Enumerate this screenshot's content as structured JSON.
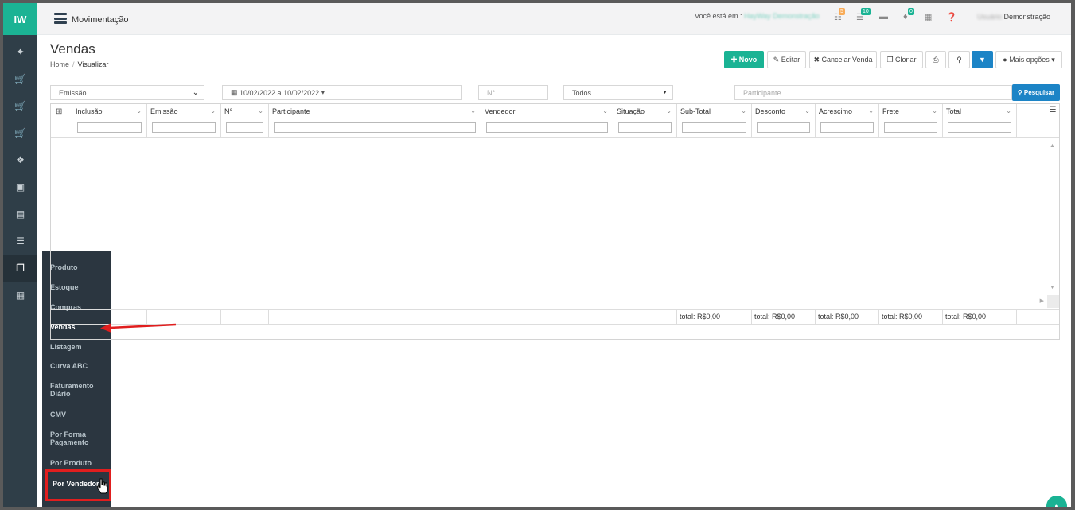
{
  "sidebar": {
    "logo": "IW",
    "icons": [
      "pin-icon",
      "cart-icon",
      "cart-icon",
      "cart-icon",
      "cubes-icon",
      "cube-icon",
      "inbox-icon",
      "list-icon",
      "reports-icon",
      "document-icon"
    ]
  },
  "flyout": {
    "items": [
      {
        "label": "Produto"
      },
      {
        "label": "Estoque"
      },
      {
        "label": "Compras"
      },
      {
        "label": "Vendas"
      },
      {
        "label": "Listagem"
      },
      {
        "label": "Curva ABC"
      },
      {
        "label": "Faturamento\nDiário"
      },
      {
        "label": "CMV"
      },
      {
        "label": "Por Forma\nPagamento"
      },
      {
        "label": "Por Produto"
      }
    ],
    "highlighted": "Por Vendedor"
  },
  "topbar": {
    "module_title": "Movimentação",
    "you_are_in_label": "Você está em :",
    "company": "HayWay Demonstração",
    "badges": {
      "b1": "5",
      "b2": "10",
      "b3": "0"
    },
    "user_prefix": "Usuário",
    "user_name": "Demonstração"
  },
  "header": {
    "title": "Vendas",
    "breadcrumb_home": "Home",
    "breadcrumb_current": "Visualizar"
  },
  "toolbar": {
    "novo": "Novo",
    "editar": "Editar",
    "cancelar": "Cancelar Venda",
    "clonar": "Clonar",
    "mais": "Mais opções"
  },
  "filters": {
    "date_type": "Emissão",
    "date_range": "10/02/2022 a 10/02/2022",
    "numero_placeholder": "N°",
    "status": "Todos",
    "participante_placeholder": "Participante",
    "search_label": "Pesquisar"
  },
  "grid": {
    "columns": [
      "Inclusão",
      "Emissão",
      "N°",
      "Participante",
      "Vendedor",
      "Situação",
      "Sub-Total",
      "Desconto",
      "Acrescimo",
      "Frete",
      "Total"
    ],
    "totals": {
      "subtotal": "total: R$0,00",
      "desconto": "total: R$0,00",
      "acrescimo": "total: R$0,00",
      "frete": "total: R$0,00",
      "total": "total: R$0,00"
    }
  },
  "colors": {
    "sidebar": "#2f3e48",
    "accent_green": "#1ab394",
    "accent_blue": "#1c84c6",
    "annotation_red": "#e01e1e"
  }
}
